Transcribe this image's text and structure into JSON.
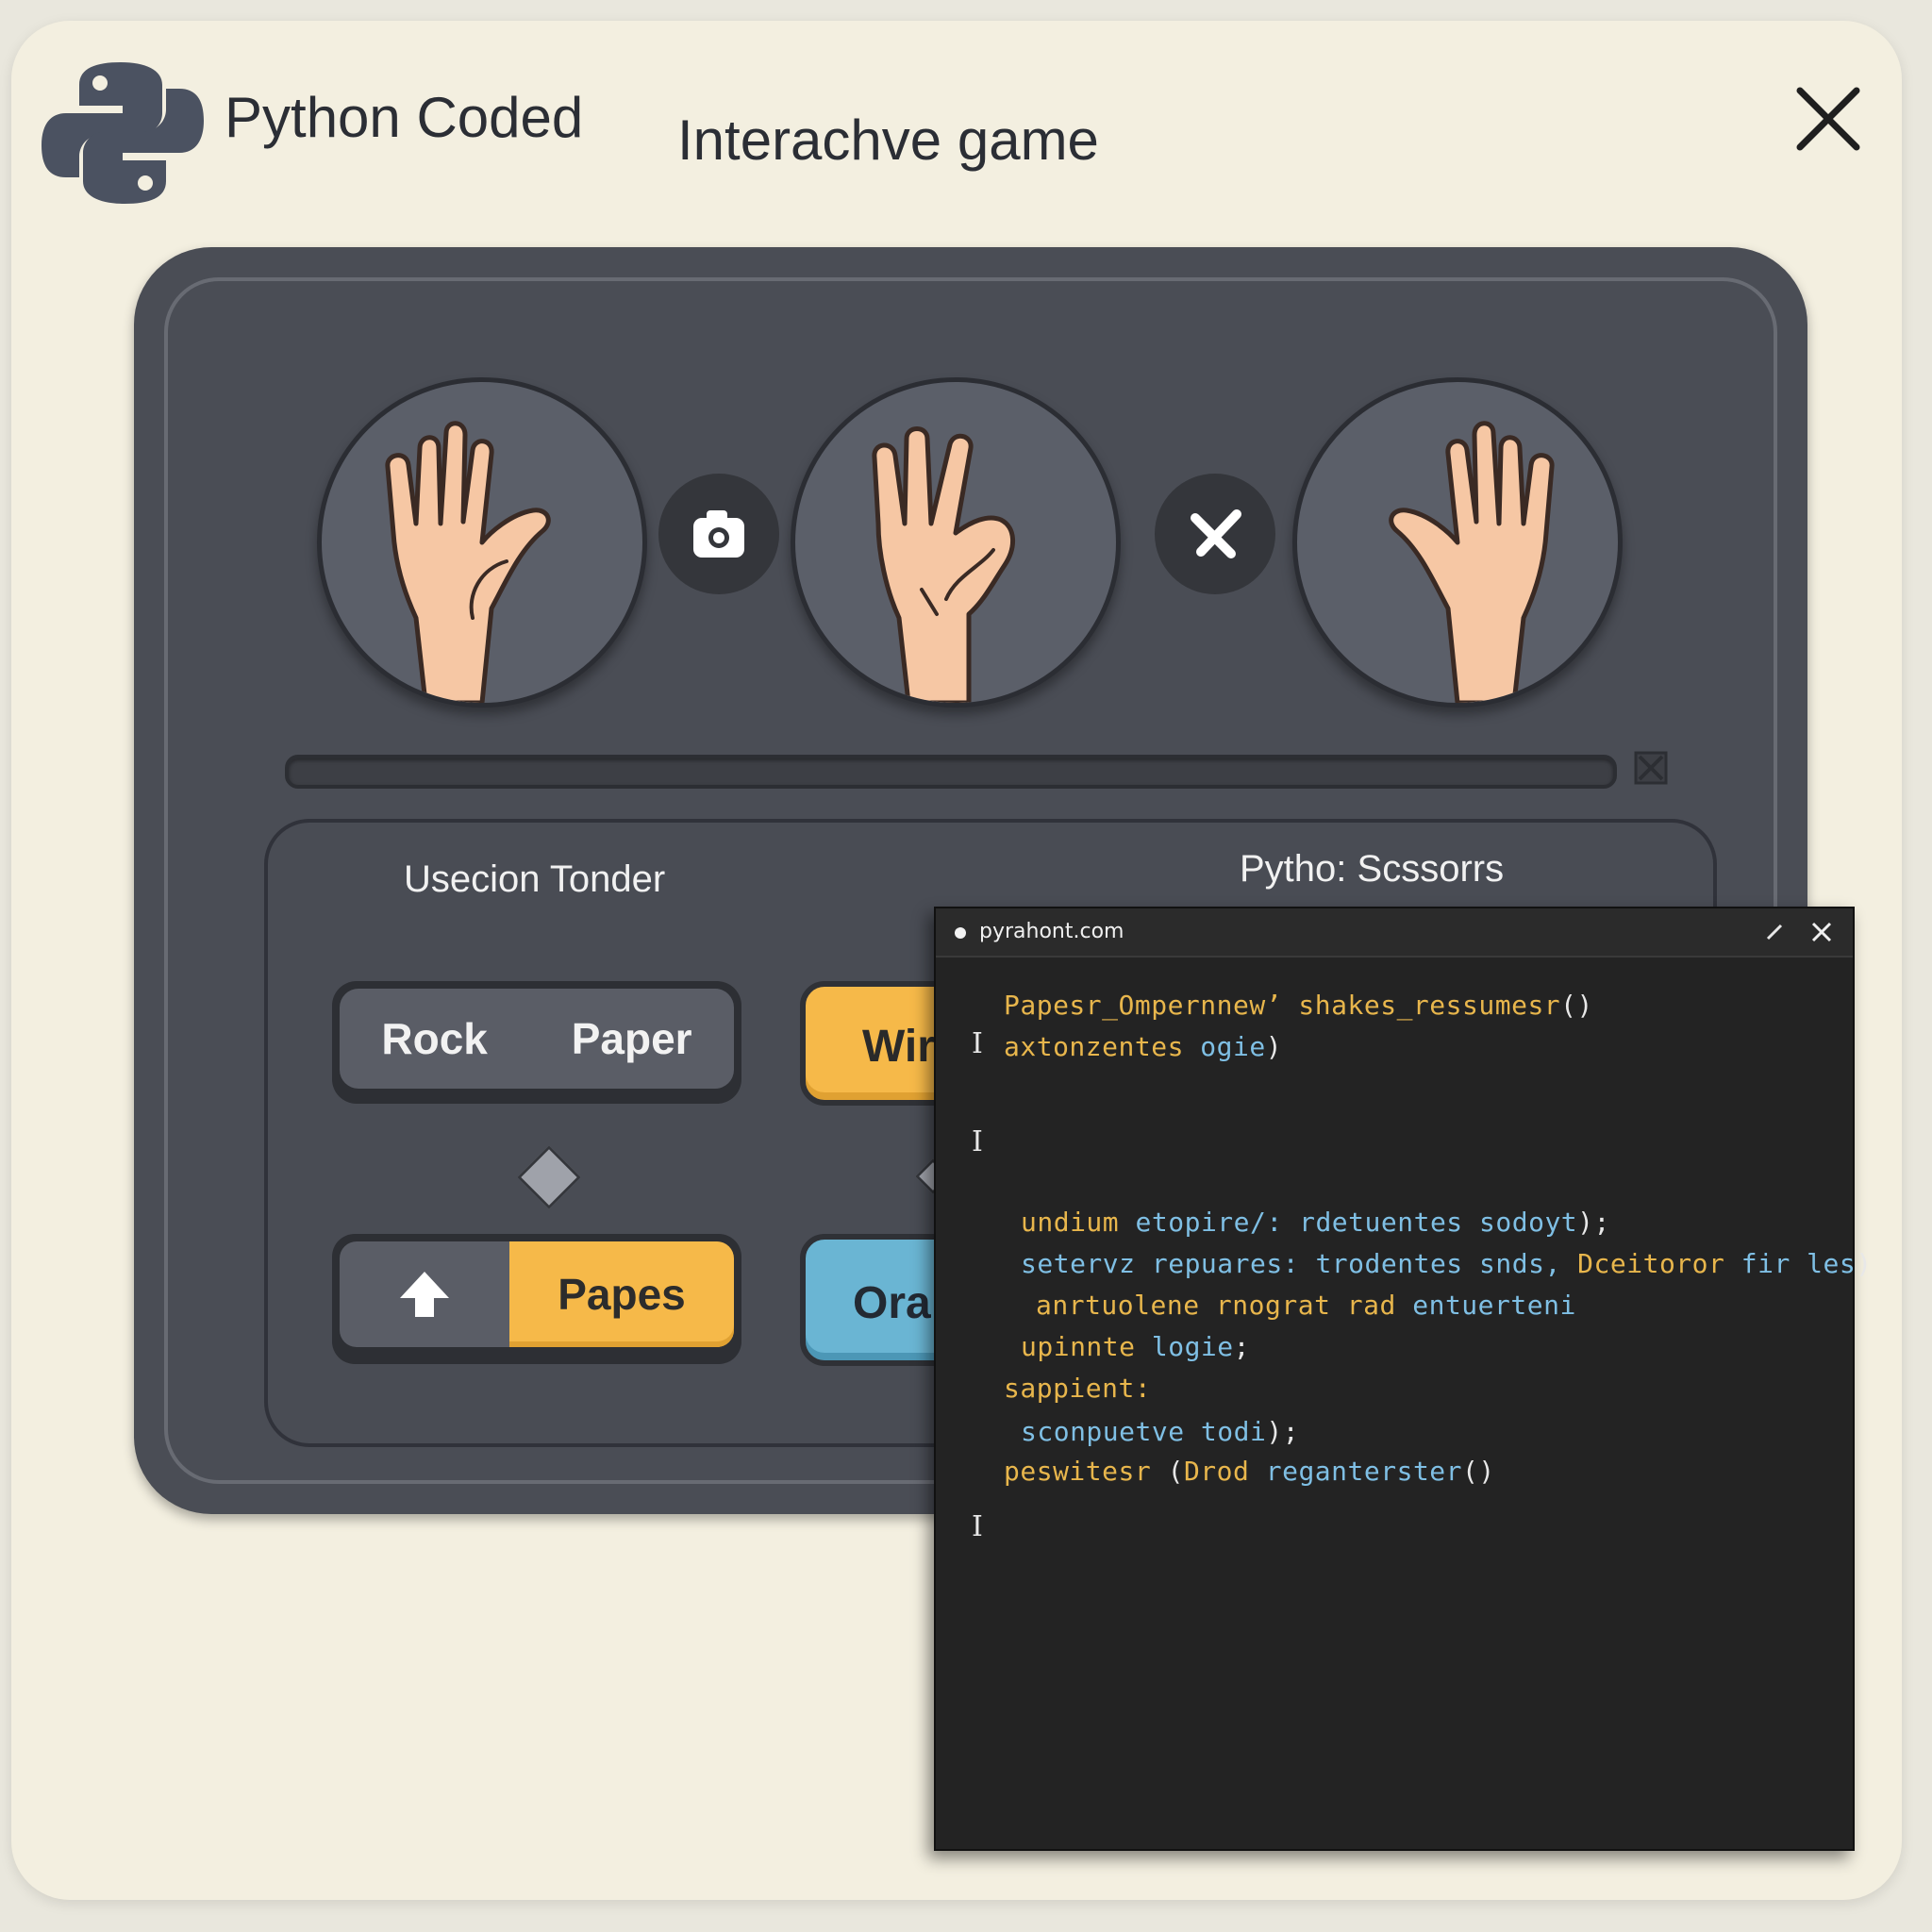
{
  "header": {
    "title": "Python Coded",
    "subtitle": "Interachve game"
  },
  "icons": {
    "logo": "python-logo-icon",
    "close": "close-icon",
    "camera": "camera-icon",
    "cross": "crossed-swords-icon"
  },
  "game": {
    "players": [
      {
        "name": "open-palm-left"
      },
      {
        "name": "pinch-hand"
      },
      {
        "name": "open-palm-right"
      }
    ],
    "progress": 0
  },
  "controls": {
    "left_title": "Usecion Tonder",
    "right_title": "Pytho: Scssorrs",
    "rock_label": "Rock",
    "paper_label": "Paper",
    "win_label": "Wir",
    "papes_label": "Papes",
    "ora_label": "Ora"
  },
  "code_window": {
    "url": "pyrahont.com",
    "lines": [
      {
        "parts": [
          {
            "t": "Papesr_Ompernnew’ shakes_ressumesr",
            "c": "yellow"
          },
          {
            "t": "()",
            "c": "white"
          }
        ]
      },
      {
        "parts": [
          {
            "t": "axtonzentes ",
            "c": "yellow"
          },
          {
            "t": "ogie",
            "c": "blue"
          },
          {
            "t": ")",
            "c": "white"
          }
        ]
      },
      {
        "parts": [
          {
            "t": "undium ",
            "c": "yellow"
          },
          {
            "t": "etopire/: rdetuentes sodoyt",
            "c": "blue"
          },
          {
            "t": ");",
            "c": "white"
          }
        ]
      },
      {
        "parts": [
          {
            "t": "setervz repuares: ",
            "c": "blue"
          },
          {
            "t": "trodentes snds, ",
            "c": "blue"
          },
          {
            "t": "Dceitoror ",
            "c": "yellow"
          },
          {
            "t": "fir les",
            "c": "blue"
          },
          {
            "t": ")",
            "c": "white"
          }
        ]
      },
      {
        "parts": [
          {
            "t": "anrtuolene rnograt rad ",
            "c": "yellow"
          },
          {
            "t": "entuerteni",
            "c": "blue"
          }
        ]
      },
      {
        "parts": [
          {
            "t": "upinnte ",
            "c": "yellow"
          },
          {
            "t": "logie",
            "c": "blue"
          },
          {
            "t": ";",
            "c": "white"
          }
        ]
      },
      {
        "parts": [
          {
            "t": "sappient:",
            "c": "yellow"
          }
        ]
      },
      {
        "parts": [
          {
            "t": "sconpuetve todi",
            "c": "blue"
          },
          {
            "t": ");",
            "c": "white"
          }
        ]
      },
      {
        "parts": [
          {
            "t": "peswitesr ",
            "c": "yellow"
          },
          {
            "t": "(",
            "c": "white"
          },
          {
            "t": "Drod ",
            "c": "yellow"
          },
          {
            "t": "reganterster",
            "c": "blue"
          },
          {
            "t": "()",
            "c": "white"
          }
        ]
      }
    ]
  },
  "colors": {
    "window_bg": "#f3efe0",
    "panel_bg": "#4a4d55",
    "accent_yellow": "#f6b949",
    "accent_blue": "#6ab5d3",
    "code_bg": "#232323"
  }
}
